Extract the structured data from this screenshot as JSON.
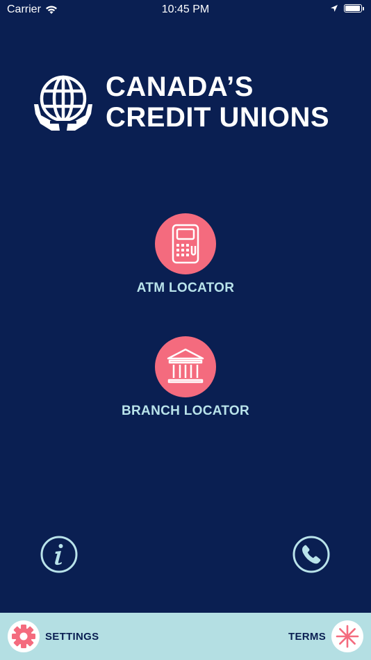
{
  "status_bar": {
    "carrier": "Carrier",
    "time": "10:45 PM",
    "battery_level": 0.95
  },
  "logo": {
    "line1": "CANADA’S",
    "line2": "CREDIT UNIONS"
  },
  "actions": {
    "atm_label": "ATM LOCATOR",
    "branch_label": "BRANCH LOCATOR"
  },
  "bottom_bar": {
    "settings_label": "SETTINGS",
    "terms_label": "TERMS"
  },
  "colors": {
    "background": "#0a1f52",
    "accent": "#f46b7e",
    "label": "#b9e3ea",
    "bottom_bar": "#b4dfe3"
  },
  "icons": {
    "info": "info-icon",
    "phone": "phone-icon",
    "settings": "gear-icon",
    "terms": "asterisk-icon",
    "atm": "atm-icon",
    "branch": "bank-building-icon",
    "logo": "globe-hands-icon"
  }
}
